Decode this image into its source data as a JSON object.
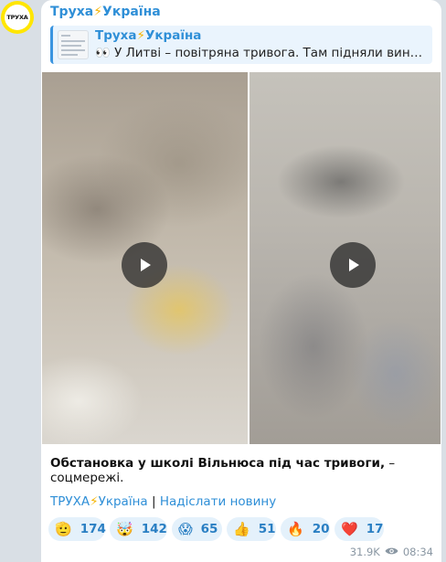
{
  "channel": {
    "avatar_text": "ТРУХА",
    "name_part1": "Труха",
    "bolt": "⚡",
    "name_part2": "Україна"
  },
  "reply": {
    "title_part1": "Труха",
    "bolt": "⚡",
    "title_part2": "Україна",
    "text": "👀 У Литві – повітряна тривога. Там підняли винищувачі"
  },
  "post": {
    "caption_bold": "Обстановка у школі Вільнюса під час тривоги,",
    "caption_rest": " – соцмережі.",
    "link1_part1": "ТРУХА",
    "link1_bolt": "⚡",
    "link1_part2": "Україна",
    "separator": " | ",
    "link2": "Надіслати новину"
  },
  "reactions": [
    {
      "emoji": "🫡",
      "count": "174"
    },
    {
      "emoji": "🤯",
      "count": "142"
    },
    {
      "emoji": "😱",
      "count": "65"
    },
    {
      "emoji": "👍",
      "count": "51"
    },
    {
      "emoji": "🔥",
      "count": "20"
    },
    {
      "emoji": "❤️",
      "count": "17"
    }
  ],
  "meta": {
    "views": "31.9K",
    "time": "08:34"
  },
  "colors": {
    "link": "#2f8fd7",
    "bolt": "#f5b400",
    "reaction_bg": "#e4f1fb"
  }
}
